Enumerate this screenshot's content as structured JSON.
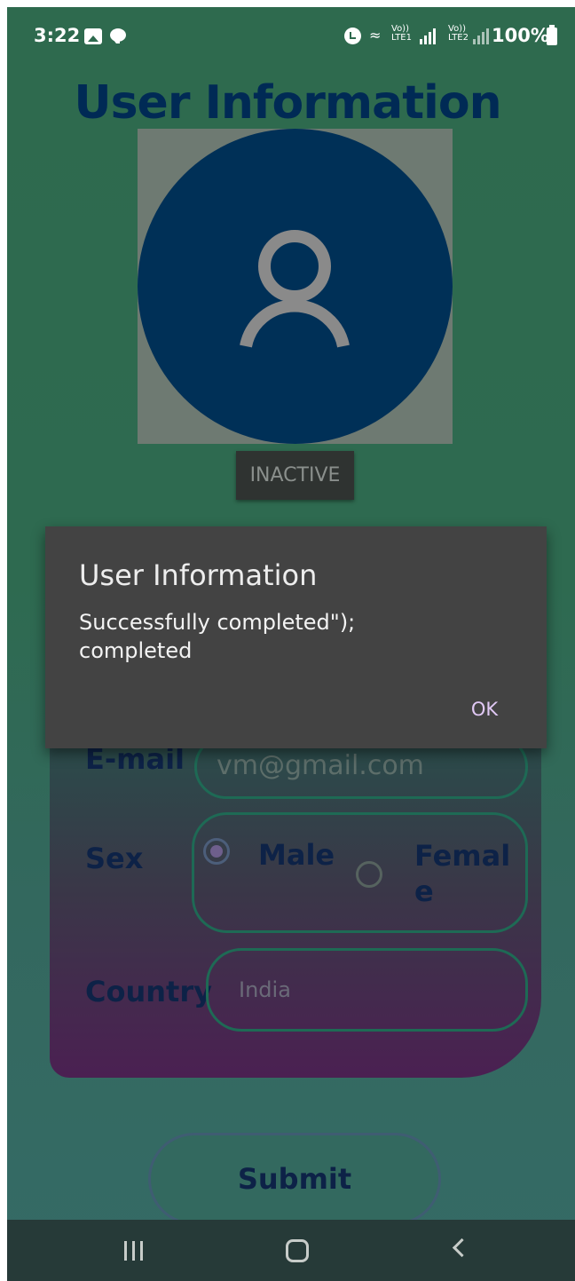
{
  "status_bar": {
    "time": "3:22",
    "wifi_icon": "wifi-icon",
    "sim1_label": "Vo))\nLTE1",
    "sim2_label": "Vo))\nLTE2",
    "battery_text": "100%"
  },
  "header": {
    "title": "User Information"
  },
  "profile": {
    "status_button": "INACTIVE"
  },
  "form": {
    "email_label": "E-mail",
    "email_value": "vm@gmail.com",
    "sex_label": "Sex",
    "male_label": "Male",
    "female_label": "Femal\ne",
    "selected_sex": "Male",
    "country_label": "Country",
    "country_placeholder": "India"
  },
  "dialog": {
    "title": "User Information",
    "message": "Successfully completed\");\ncompleted",
    "ok_label": "OK"
  },
  "submit": {
    "label": "Submit"
  },
  "colors": {
    "background": "#2e6a4e",
    "title_color": "#002a55",
    "dialog_bg": "#434343",
    "accent": "#e0c8f4"
  }
}
